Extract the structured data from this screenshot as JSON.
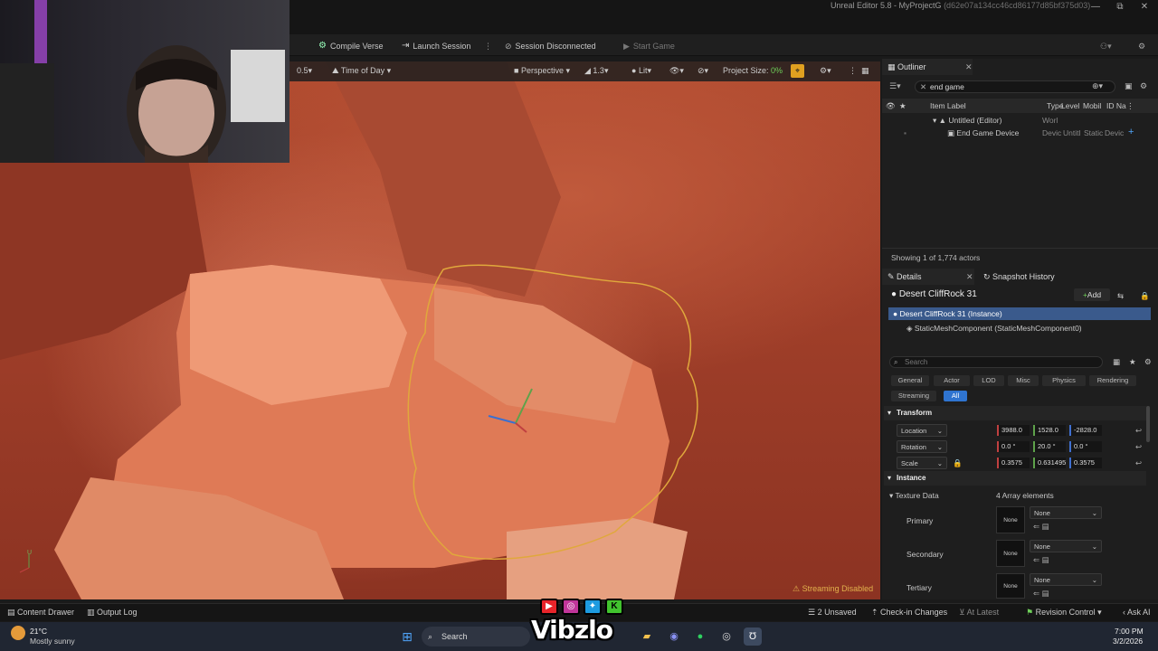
{
  "window": {
    "title": "Unreal Editor 5.8 - MyProjectG",
    "hash": "(d62e07a134cc46cd86177d85bf375d03)",
    "controls": [
      "—",
      "⧉",
      "✕"
    ]
  },
  "toolbar": {
    "compile_label": "Compile Verse",
    "launch_label": "Launch Session",
    "session_label": "Session Disconnected",
    "start_label": "Start Game"
  },
  "viewport": {
    "speed": "0.5",
    "time_of_day": "Time of Day",
    "view_mode": "Perspective",
    "fov": "1.3",
    "lighting": "Lit",
    "project_size_label": "Project Size:",
    "project_size_value": "0%",
    "streaming_status": "Streaming Disabled",
    "axis_label": "U"
  },
  "outliner": {
    "tab": "Outliner",
    "search_value": "end game",
    "columns": [
      "Item Label",
      "Type",
      "Level",
      "Mobil",
      "ID Na"
    ],
    "rows": [
      {
        "label": "Untitled (Editor)",
        "type": "Worl"
      },
      {
        "label": "End Game Device",
        "type": "Devic",
        "level": "Untitl",
        "mobility": "Static",
        "id": "Devic"
      }
    ],
    "status": "Showing 1 of 1,774 actors"
  },
  "details": {
    "tab": "Details",
    "tab2": "Snapshot History",
    "actor_name": "Desert CliffRock 31",
    "add_label": "Add",
    "instance_label": "Desert CliffRock 31 (Instance)",
    "component_label": "StaticMeshComponent (StaticMeshComponent0)",
    "search_placeholder": "Search",
    "filters": [
      "General",
      "Actor",
      "LOD",
      "Misc",
      "Physics",
      "Rendering"
    ],
    "filters2": [
      "Streaming",
      "All"
    ],
    "transform_header": "Transform",
    "location_label": "Location",
    "location": [
      "3988.0",
      "1528.0",
      "-2828.0"
    ],
    "rotation_label": "Rotation",
    "rotation": [
      "0.0 °",
      "20.0 °",
      "0.0 °"
    ],
    "scale_label": "Scale",
    "scale": [
      "0.3575",
      "0.631495",
      "0.3575"
    ],
    "instance_header": "Instance",
    "texture_data_label": "Texture Data",
    "array_count": "4 Array elements",
    "slots": [
      {
        "label": "Primary",
        "thumb": "None",
        "value": "None"
      },
      {
        "label": "Secondary",
        "thumb": "None",
        "value": "None"
      },
      {
        "label": "Tertiary",
        "thumb": "None",
        "value": "None"
      }
    ]
  },
  "bottom": {
    "content_drawer": "Content Drawer",
    "output_log": "Output Log",
    "unsaved": "2 Unsaved",
    "checkin": "Check-in Changes",
    "at_latest": "At Latest",
    "revision": "Revision Control",
    "ask": "Ask AI"
  },
  "taskbar": {
    "temperature": "21°C",
    "weather": "Mostly sunny",
    "search_label": "Search",
    "time": "7:00 PM",
    "date": "3/2/2026"
  },
  "overlay": {
    "brand": "Vibzlo"
  }
}
